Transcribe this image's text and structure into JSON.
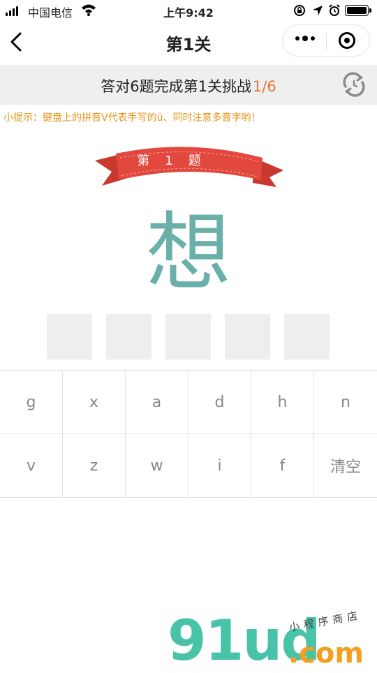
{
  "status_bar": {
    "carrier": "中国电信",
    "time": "上午9:42"
  },
  "nav": {
    "title": "第1关"
  },
  "banner": {
    "text": "答对6题完成第1关挑战",
    "progress": "1/6"
  },
  "hint": "小提示：键盘上的拼音V代表手写的ü、同时注意多音字哟！",
  "question": {
    "ribbon_label": "第1题",
    "character": "想",
    "answer_slots": 5
  },
  "keyboard": {
    "row1": [
      "g",
      "x",
      "a",
      "d",
      "h",
      "n"
    ],
    "row2": [
      "v",
      "z",
      "w",
      "i",
      "f",
      "清空"
    ]
  },
  "watermark": {
    "number": "91ud",
    "domain": ".com",
    "tagline": "小程序商店"
  },
  "colors": {
    "accent_orange": "#e8733e",
    "hint_orange": "#e6931b",
    "character_teal": "#6ab0a8",
    "ribbon_red": "#e2483d"
  }
}
